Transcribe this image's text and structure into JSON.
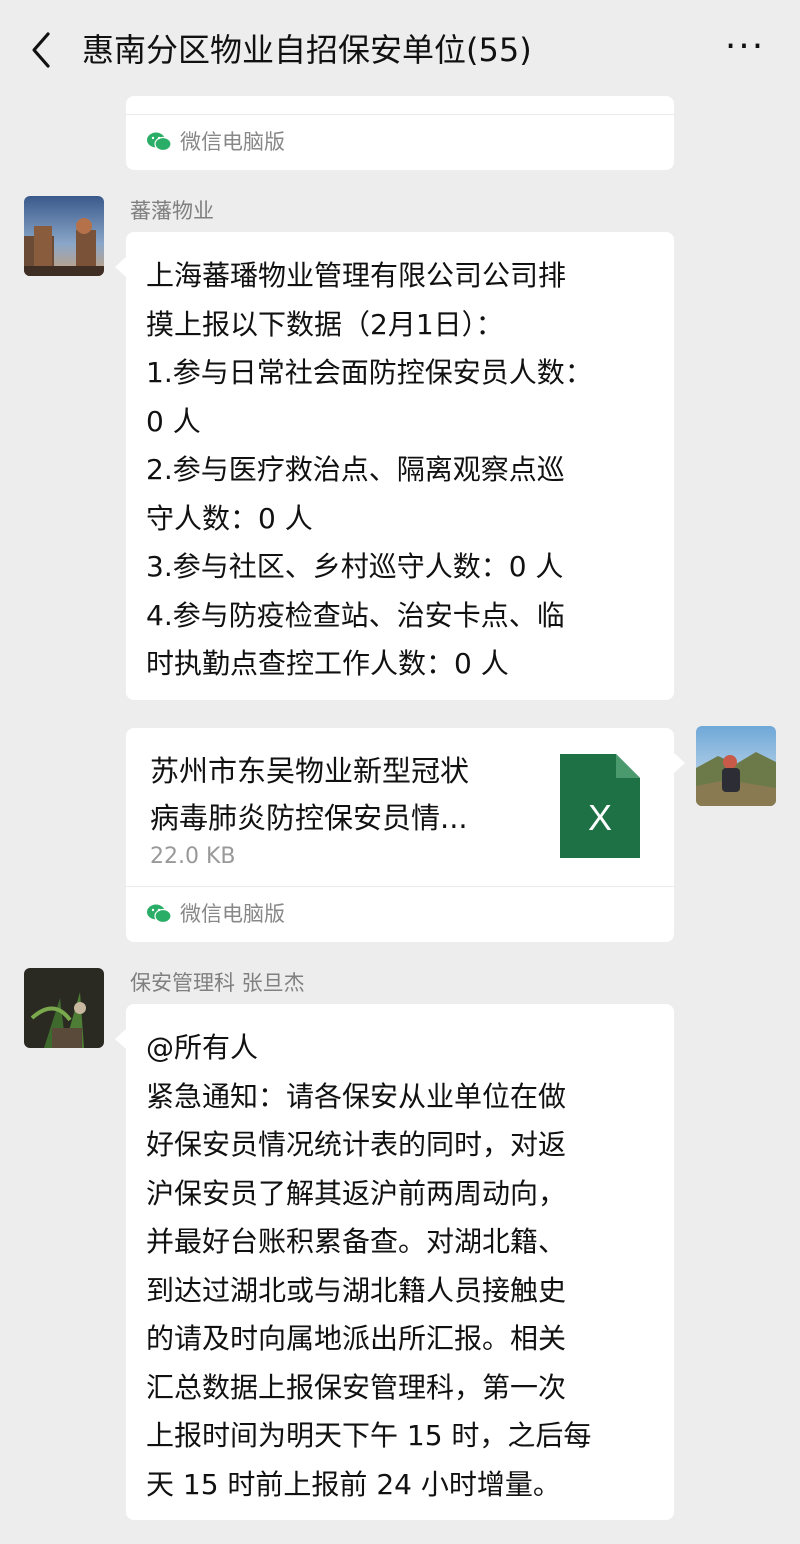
{
  "header": {
    "title": "惠南分区物业自招保安单位(55)",
    "more_label": "···"
  },
  "messages": [
    {
      "source": "微信电脑版"
    },
    {
      "sender": "蕃藩物业",
      "text": "上海蕃璠物业管理有限公司公司排\n摸上报以下数据（2月1日）：\n1.参与日常社会面防控保安员人数：\n0 人\n2.参与医疗救治点、隔离观察点巡\n守人数：0 人\n3.参与社区、乡村巡守人数：0 人\n4.参与防疫检查站、治安卡点、临\n时执勤点查控工作人数：0 人"
    },
    {
      "file_title": "苏州市东吴物业新型冠状\n病毒肺炎防控保安员情...",
      "file_size": "22.0 KB",
      "file_icon_letter": "X",
      "source": "微信电脑版"
    },
    {
      "sender": "保安管理科 张旦杰",
      "text": "@所有人\n紧急通知：请各保安从业单位在做\n好保安员情况统计表的同时，对返\n沪保安员了解其返沪前两周动向，\n并最好台账积累备查。对湖北籍、\n到达过湖北或与湖北籍人员接触史\n的请及时向属地派出所汇报。相关\n汇总数据上报保安管理科，第一次\n上报时间为明天下午 15 时，之后每\n天 15 时前上报前 24 小时增量。"
    }
  ],
  "colors": {
    "background": "#ededed",
    "bubble": "#ffffff",
    "excel_green": "#1e7145",
    "wechat_green": "#2aae67"
  }
}
